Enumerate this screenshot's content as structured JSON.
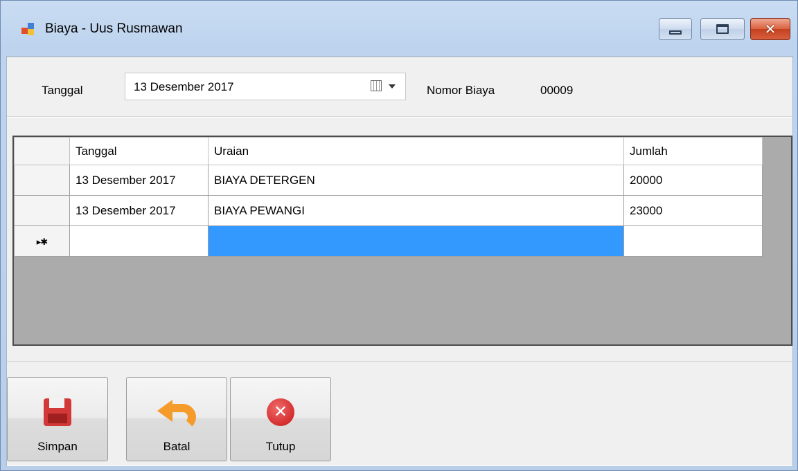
{
  "window": {
    "title": "Biaya - Uus Rusmawan",
    "minimize_icon": "minimize-icon",
    "maximize_icon": "maximize-icon",
    "close_icon": "close-icon",
    "close_glyph": "✕"
  },
  "header": {
    "tanggal_label": "Tanggal",
    "tanggal_value": "13 Desember 2017",
    "nomor_label": "Nomor Biaya",
    "nomor_value": "00009"
  },
  "grid": {
    "columns": [
      "Tanggal",
      "Uraian",
      "Jumlah"
    ],
    "rows": [
      {
        "tanggal": "13 Desember 2017",
        "uraian": "BIAYA DETERGEN",
        "jumlah": "20000"
      },
      {
        "tanggal": "13 Desember 2017",
        "uraian": "BIAYA PEWANGI",
        "jumlah": "23000"
      }
    ],
    "new_row_marker": "▸✱",
    "selection_color": "#3399ff"
  },
  "actions": {
    "simpan": "Simpan",
    "batal": "Batal",
    "tutup": "Tutup",
    "tutup_glyph": "✕"
  }
}
